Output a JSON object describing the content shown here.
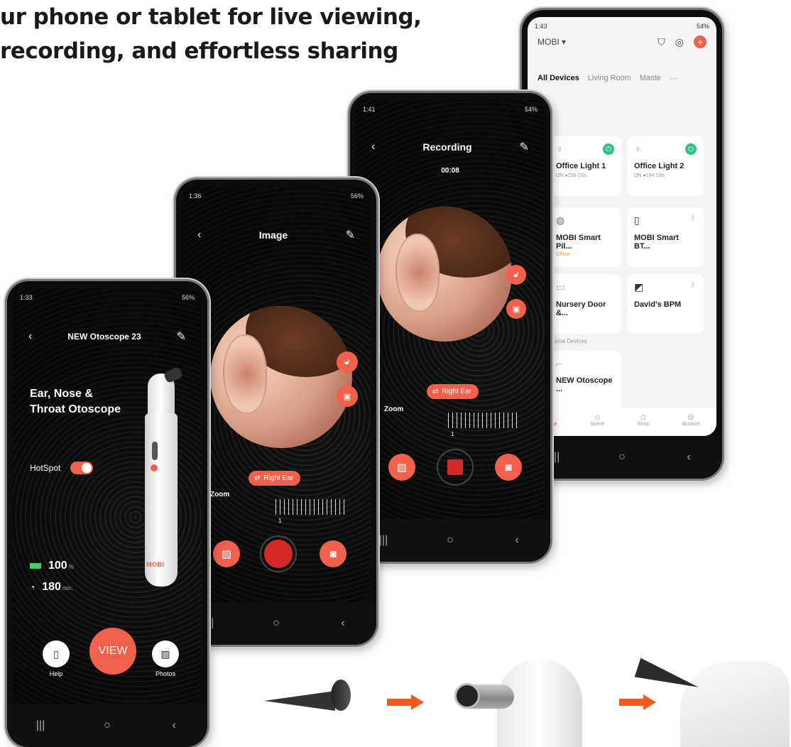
{
  "headline": {
    "line1": "ur phone or tablet for live viewing,",
    "line2": "recording, and effortless sharing"
  },
  "phone_home": {
    "status_time": "1:33",
    "status_right": "56%",
    "title": "NEW Otoscope 23",
    "product_name_line1": "Ear, Nose &",
    "product_name_line2": "Throat Otoscope",
    "device_brand": "MOBI",
    "hotspot_label": "HotSpot",
    "battery_value": "100",
    "battery_unit": "%",
    "time_value": "180",
    "time_unit": "min.",
    "view_label": "VIEW",
    "help_label": "Help",
    "photos_label": "Photos"
  },
  "phone_image": {
    "status_time": "1:36",
    "status_right": "56%",
    "title": "Image",
    "ear_label": "Right Ear",
    "zoom_label": "Zoom",
    "zoom_value": "1"
  },
  "phone_recording": {
    "status_time": "1:41",
    "status_right": "54%",
    "title": "Recording",
    "timer": "00:08",
    "ear_label": "Right Ear",
    "zoom_label": "Zoom",
    "zoom_value": "1"
  },
  "phone_app": {
    "status_time": "1:43",
    "status_right": "54%",
    "home_name": "MOBI",
    "tabs": [
      "All Devices",
      "Living Room",
      "Maste"
    ],
    "devices": [
      {
        "name": "Office Light 1",
        "sub": "ON ●236 ⏱0s"
      },
      {
        "name": "Office Light 2",
        "sub": "ON ●164 ⏱0s"
      },
      {
        "name": "MOBI Smart Pil...",
        "sub": "Offline"
      },
      {
        "name": "MOBI Smart BT...",
        "sub": ""
      },
      {
        "name": "Nursery Door &...",
        "sub": ""
      },
      {
        "name": "David's BPM",
        "sub": ""
      }
    ],
    "section_label": "Local Devices",
    "local_device": "NEW Otoscope ...",
    "offline_label": "Offline",
    "nav": [
      "Home",
      "Scene",
      "Shop",
      "Account"
    ]
  },
  "colors": {
    "accent": "#f0604a",
    "record": "#d42a25",
    "arrow": "#f05a1e",
    "power_on": "#2ec27e"
  }
}
